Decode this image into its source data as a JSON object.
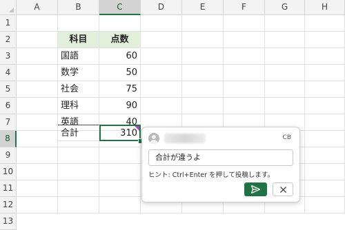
{
  "columns": [
    "A",
    "B",
    "C",
    "D",
    "E",
    "F",
    "G",
    "H"
  ],
  "rows": [
    "1",
    "2",
    "3",
    "4",
    "5",
    "6",
    "7",
    "8",
    "9",
    "10",
    "11",
    "12",
    "13"
  ],
  "table": {
    "header": {
      "subject": "科目",
      "score": "点数"
    },
    "items": [
      {
        "subject": "国語",
        "score": "60"
      },
      {
        "subject": "数学",
        "score": "50"
      },
      {
        "subject": "社会",
        "score": "75"
      },
      {
        "subject": "理科",
        "score": "90"
      },
      {
        "subject": "英語",
        "score": "40"
      }
    ],
    "total": {
      "label": "合計",
      "value": "310"
    }
  },
  "active_cell": "C8",
  "comment": {
    "initials": "CB",
    "draft_text": "合計が違うよ",
    "hint": "ヒント: Ctrl+Enter を押して投稿します。",
    "post_icon": "send-icon",
    "cancel_icon": "close-icon"
  },
  "colors": {
    "accent": "#217346",
    "header_fill": "#e2efda",
    "comment_marker": "#a14bc3"
  }
}
